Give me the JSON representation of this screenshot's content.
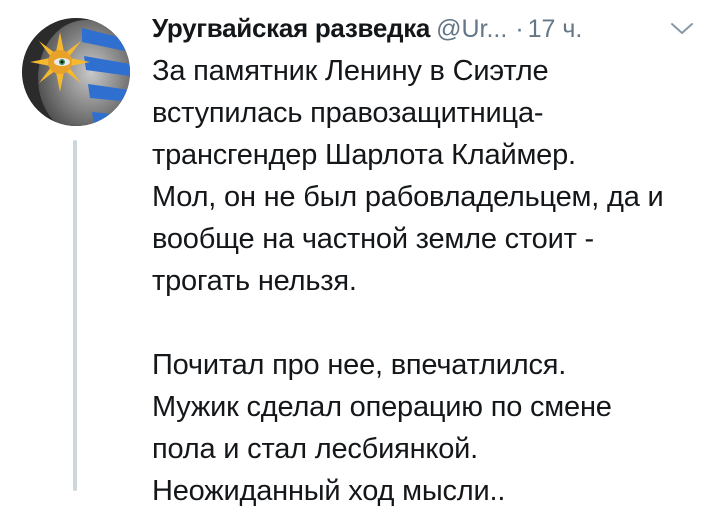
{
  "tweet": {
    "author": {
      "display_name": "Уругвайская разведка",
      "handle": "@Ur...",
      "avatar_icon": "face-painted-uruguay-flag-avatar"
    },
    "separator": "·",
    "timestamp": "17 ч.",
    "menu_icon": "chevron-down-icon",
    "text_paragraphs": [
      [
        "За памятник Ленину в Сиэтле",
        "вступилась правозащитница-",
        "трансгендер Шарлота Клаймер.",
        "Мол, он не был рабовладельцем, да и",
        "вообще на частной земле стоит -",
        "трогать нельзя."
      ],
      [
        "Почитал про нее, впечатлился.",
        "Мужик сделал операцию по смене",
        "пола и стал лесбиянкой.",
        "Неожиданный ход мысли.."
      ]
    ]
  },
  "colors": {
    "text_primary": "#14171a",
    "text_secondary": "#657786",
    "thread_line": "#ccd6dd",
    "flag_blue": "#2f6fd0",
    "sun_yellow": "#f5b82e"
  }
}
